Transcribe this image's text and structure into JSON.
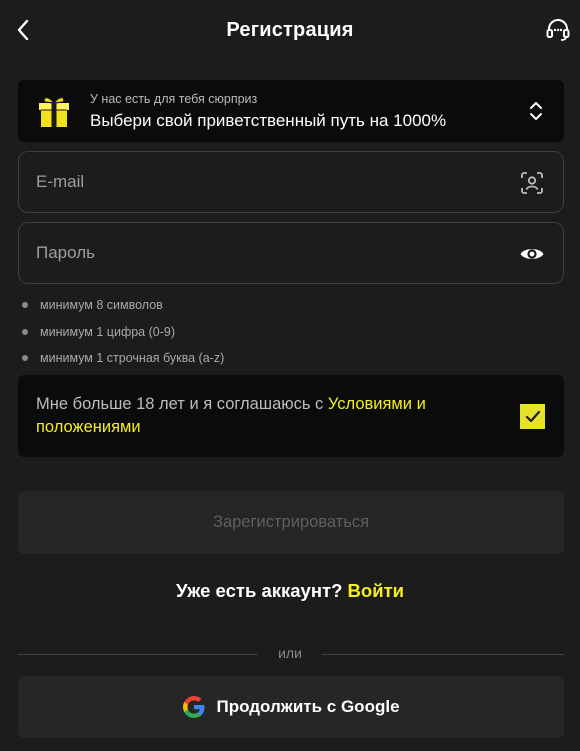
{
  "header": {
    "title": "Регистрация",
    "back_icon": "chevron-left-icon",
    "support_icon": "headset-icon"
  },
  "promo": {
    "subtitle": "У нас есть для тебя сюрприз",
    "title": "Выбери свой приветственный путь на 1000%",
    "icon": "gift-icon",
    "expand_icon": "chevron-up-down-icon"
  },
  "form": {
    "email_placeholder": "E-mail",
    "email_value": "",
    "password_placeholder": "Пароль",
    "password_value": "",
    "email_icon": "face-scan-icon",
    "password_icon": "eye-icon"
  },
  "password_rules": [
    "минимум 8 символов",
    "минимум 1 цифра (0-9)",
    "минимум 1 строчная буква (a-z)"
  ],
  "terms": {
    "text_before": "Мне больше 18 лет и я соглашаюсь с ",
    "link_text": "Условиями и положениями",
    "checked": true
  },
  "register_button": "Зарегистрироваться",
  "login": {
    "prompt": "Уже есть аккаунт?",
    "link": "Войти"
  },
  "divider_text": "или",
  "google_button": "Продолжить с Google",
  "colors": {
    "background": "#1c1c1c",
    "accent": "#f5ef1e",
    "panel": "#0b0b0b",
    "button_disabled": "#262626"
  }
}
